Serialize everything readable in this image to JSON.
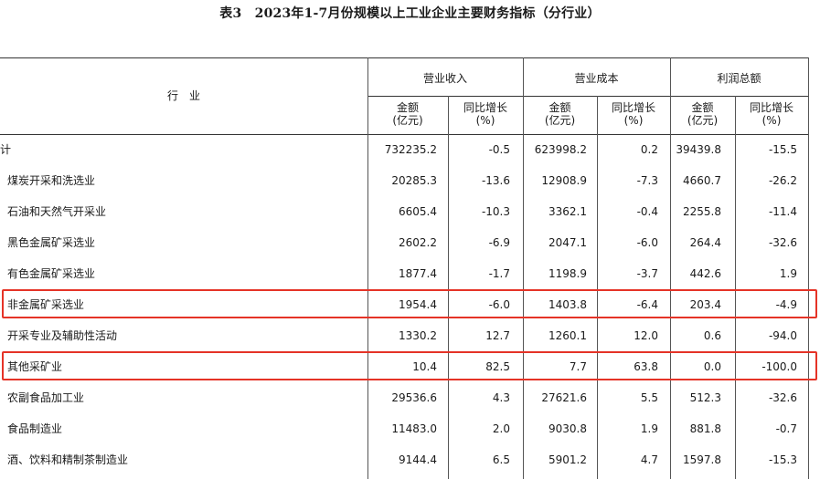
{
  "title": "表3　2023年1-7月份规模以上工业企业主要财务指标（分行业）",
  "header": {
    "industry": "行　业",
    "groups": [
      "营业收入",
      "营业成本",
      "利润总额"
    ],
    "amount": [
      "金额",
      "(亿元)"
    ],
    "growth": [
      "同比增长",
      "(%)"
    ]
  },
  "rows": [
    {
      "name": "总计",
      "values": [
        "732235.2",
        "-0.5",
        "623998.2",
        "0.2",
        "39439.8",
        "-15.5"
      ]
    },
    {
      "name": "煤炭开采和洗选业",
      "values": [
        "20285.3",
        "-13.6",
        "12908.9",
        "-7.3",
        "4660.7",
        "-26.2"
      ]
    },
    {
      "name": "石油和天然气开采业",
      "values": [
        "6605.4",
        "-10.3",
        "3362.1",
        "-0.4",
        "2255.8",
        "-11.4"
      ]
    },
    {
      "name": "黑色金属矿采选业",
      "values": [
        "2602.2",
        "-6.9",
        "2047.1",
        "-6.0",
        "264.4",
        "-32.6"
      ]
    },
    {
      "name": "有色金属矿采选业",
      "values": [
        "1877.4",
        "-1.7",
        "1198.9",
        "-3.7",
        "442.6",
        "1.9"
      ]
    },
    {
      "name": "非金属矿采选业",
      "values": [
        "1954.4",
        "-6.0",
        "1403.8",
        "-6.4",
        "203.4",
        "-4.9"
      ],
      "highlight": true
    },
    {
      "name": "开采专业及辅助性活动",
      "values": [
        "1330.2",
        "12.7",
        "1260.1",
        "12.0",
        "0.6",
        "-94.0"
      ]
    },
    {
      "name": "其他采矿业",
      "values": [
        "10.4",
        "82.5",
        "7.7",
        "63.8",
        "0.0",
        "-100.0"
      ],
      "highlight": true
    },
    {
      "name": "农副食品加工业",
      "values": [
        "29536.6",
        "4.3",
        "27621.6",
        "5.5",
        "512.3",
        "-32.6"
      ]
    },
    {
      "name": "食品制造业",
      "values": [
        "11483.0",
        "2.0",
        "9030.8",
        "1.9",
        "881.8",
        "-0.7"
      ]
    },
    {
      "name": "酒、饮料和精制茶制造业",
      "values": [
        "9144.4",
        "6.5",
        "5901.2",
        "4.7",
        "1597.8",
        "-15.3"
      ]
    }
  ],
  "colors": {
    "highlight": "#e53327",
    "text": "#1a1a1a"
  }
}
